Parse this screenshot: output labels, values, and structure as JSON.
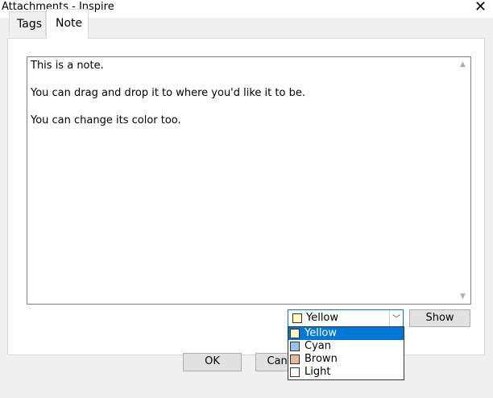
{
  "window": {
    "title": "Attachments - Inspire",
    "close_glyph": "✕"
  },
  "tabs": [
    {
      "label": "Tags"
    },
    {
      "label": "Note"
    }
  ],
  "note": {
    "lines": [
      "This is a note.",
      "You can drag and drop it to where you'd like it to be.",
      "You can change its color too."
    ]
  },
  "color_select": {
    "selected": "Yellow",
    "options": [
      {
        "label": "Yellow",
        "color": "#fff8c4"
      },
      {
        "label": "Cyan",
        "color": "#9cc3ee"
      },
      {
        "label": "Brown",
        "color": "#e8b898"
      },
      {
        "label": "Light",
        "color": "#ffffff"
      }
    ],
    "highlight_color": "#0078d7"
  },
  "buttons": {
    "show": "Show",
    "ok": "OK",
    "cancel": "Cancel"
  }
}
